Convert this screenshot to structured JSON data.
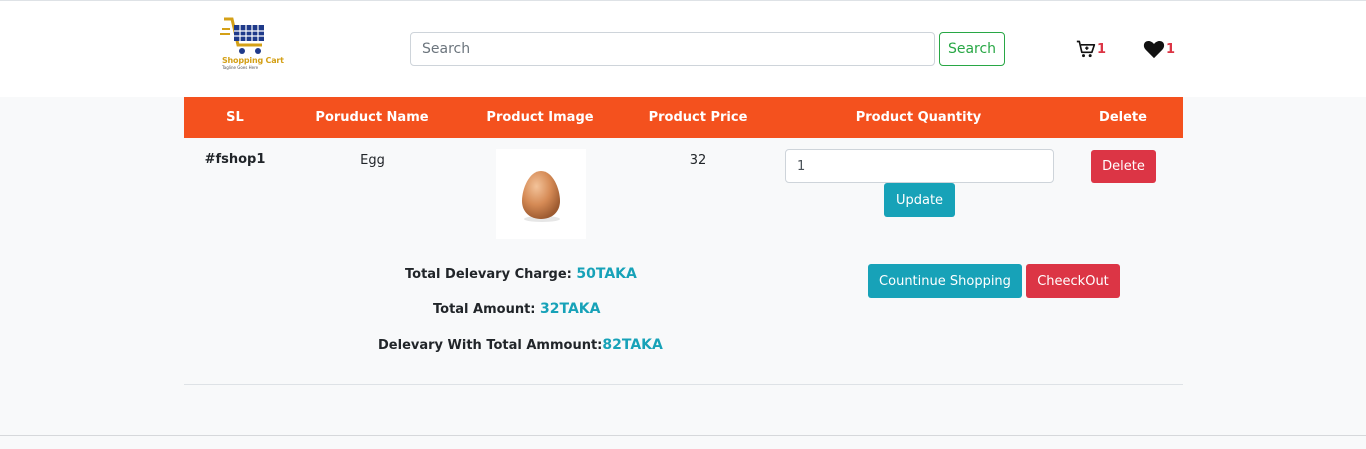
{
  "brand": {
    "logo_text": "Shopping Cart",
    "logo_tagline": "Tagline Goes Here"
  },
  "search": {
    "placeholder": "Search",
    "value": "",
    "button_label": "Search"
  },
  "nav": {
    "cart_count": "1",
    "wishlist_count": "1"
  },
  "table": {
    "headers": [
      "SL",
      "Poruduct Name",
      "Product Image",
      "Product Price",
      "Product Quantity",
      "Delete"
    ],
    "rows": [
      {
        "sl": "#fshop1",
        "name": "Egg",
        "image": "egg-image",
        "price": "32",
        "quantity": "1",
        "update_label": "Update",
        "delete_label": "Delete"
      }
    ]
  },
  "totals": {
    "delivery_label": "Total Delevary Charge: ",
    "delivery_value": "50TAKA",
    "amount_label": "Total Amount: ",
    "amount_value": "32TAKA",
    "grand_label": "Delevary With Total Ammount:",
    "grand_value": "82TAKA"
  },
  "actions": {
    "continue_label": "Countinue Shopping",
    "checkout_label": "CheeckOut"
  },
  "colors": {
    "accent": "#f4511e",
    "info": "#17a2b8",
    "danger": "#dc3545",
    "success": "#28a745"
  },
  "icons": {
    "cart": "cart-icon",
    "wishlist": "heart-icon"
  }
}
